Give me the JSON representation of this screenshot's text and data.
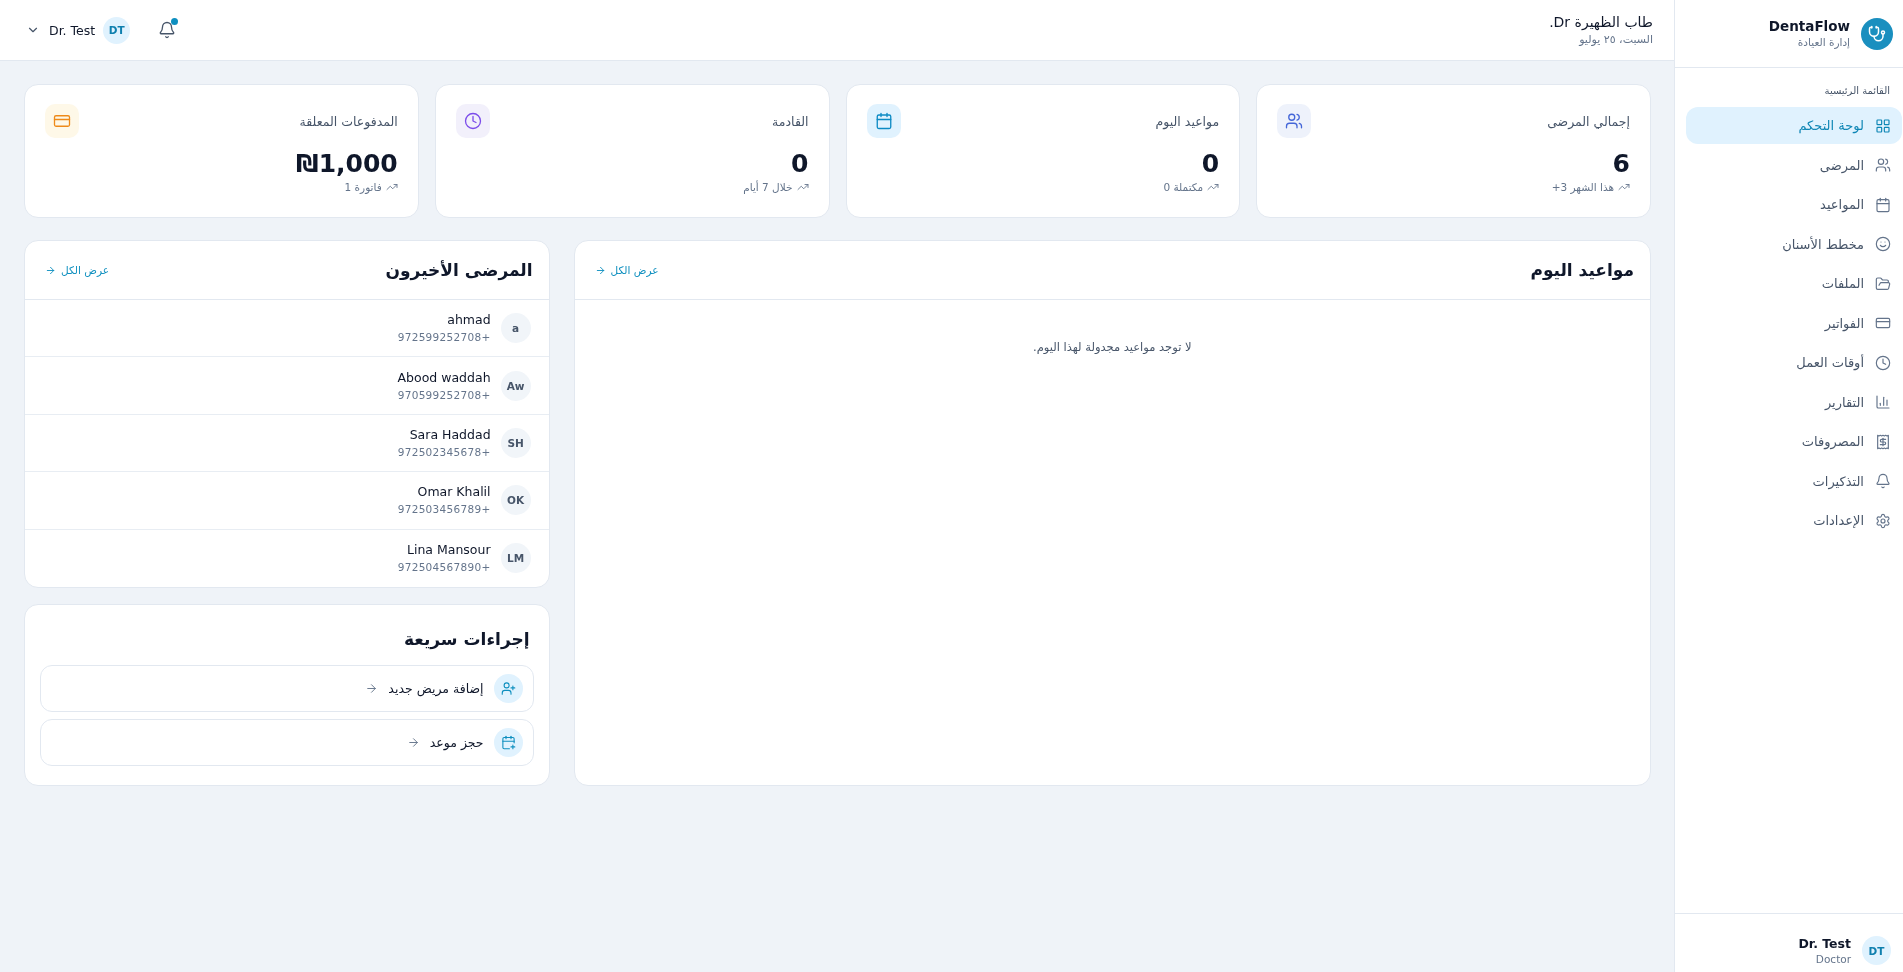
{
  "sidebar": {
    "brand": {
      "name": "DentaFlow",
      "subtitle": "إدارة العيادة"
    },
    "section_title": "القائمة الرئيسية",
    "items": [
      {
        "label": "لوحة التحكم",
        "kind": "grid",
        "selected": true
      },
      {
        "label": "المرضى",
        "kind": "users",
        "selected": false
      },
      {
        "label": "المواعيد",
        "kind": "calendar",
        "selected": false
      },
      {
        "label": "مخطط الأسنان",
        "kind": "smile",
        "selected": false
      },
      {
        "label": "الملفات",
        "kind": "folder",
        "selected": false
      },
      {
        "label": "الفواتير",
        "kind": "card",
        "selected": false
      },
      {
        "label": "أوقات العمل",
        "kind": "clock",
        "selected": false
      },
      {
        "label": "التقارير",
        "kind": "chart",
        "selected": false
      },
      {
        "label": "المصروفات",
        "kind": "receipt",
        "selected": false
      },
      {
        "label": "التذكيرات",
        "kind": "bell",
        "selected": false
      },
      {
        "label": "الإعدادات",
        "kind": "settings",
        "selected": false
      }
    ],
    "user": {
      "initials": "DT",
      "name": "Dr. Test",
      "role": "Doctor"
    }
  },
  "header": {
    "greeting": "طاب الظهيرة Dr.",
    "date": "السبت، ٢٥ يوليو",
    "notifications": {
      "unread": true
    },
    "user": {
      "initials": "DT",
      "name": "Dr. Test"
    }
  },
  "stats": [
    {
      "label": "إجمالي المرضى",
      "kind": "users",
      "value": "6",
      "note": "+3 هذا الشهر"
    },
    {
      "label": "مواعيد اليوم",
      "kind": "calendar",
      "value": "0",
      "note": "0 مكتملة"
    },
    {
      "label": "القادمة",
      "kind": "clock",
      "value": "0",
      "note": "خلال 7 أيام"
    },
    {
      "label": "المدفوعات المعلقة",
      "kind": "card",
      "value": "₪1,000",
      "note": "1 فاتورة"
    }
  ],
  "appointments": {
    "title": "مواعيد اليوم",
    "link": "عرض الكل",
    "empty_text": "لا توجد مواعيد مجدولة لهذا اليوم."
  },
  "recent_patients": {
    "title": "المرضى الأخيرون",
    "link": "عرض الكل",
    "rows": [
      {
        "initials": "a",
        "name": "ahmad",
        "phone": "+972599252708"
      },
      {
        "initials": "Aw",
        "name": "Abood waddah",
        "phone": "+970599252708"
      },
      {
        "initials": "SH",
        "name": "Sara Haddad",
        "phone": "+972502345678"
      },
      {
        "initials": "OK",
        "name": "Omar Khalil",
        "phone": "+972503456789"
      },
      {
        "initials": "LM",
        "name": "Lina Mansour",
        "phone": "+972504567890"
      }
    ]
  },
  "quick_actions": {
    "title": "إجراءات سريعة",
    "items": [
      {
        "label": "إضافة مريض جديد",
        "kind": "add-user"
      },
      {
        "label": "حجز موعد",
        "kind": "calendar-plus"
      }
    ]
  }
}
